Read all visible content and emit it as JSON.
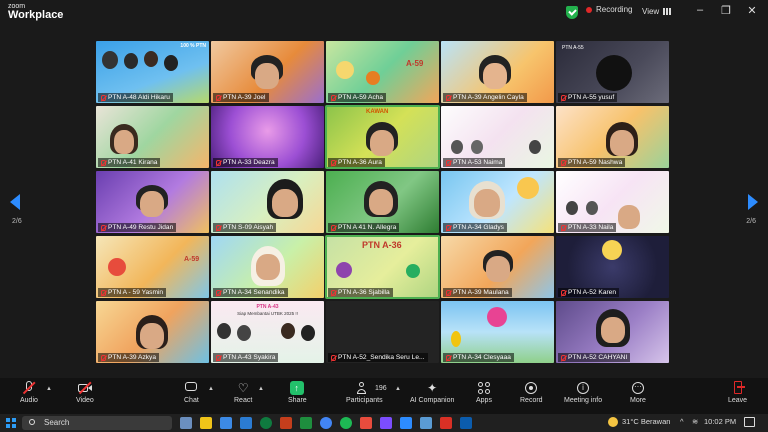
{
  "app": {
    "logo_top": "zoom",
    "logo_bottom": "Workplace"
  },
  "header": {
    "recording_label": "Recording",
    "view_label": "View"
  },
  "pagination": {
    "left": "2/6",
    "right": "2/6"
  },
  "participants": [
    {
      "name": "PTN A-48 Aldi Hikaru"
    },
    {
      "name": "PTN A-39 Joel"
    },
    {
      "name": "PTN A-59 Acha"
    },
    {
      "name": "PTN A-39 Angelin Cayla"
    },
    {
      "name": "PTN A-55 yusuf"
    },
    {
      "name": "PTN A-41 Kirana"
    },
    {
      "name": "PTN A-33 Deazra"
    },
    {
      "name": "PTN A-36 Aura"
    },
    {
      "name": "PTN A-53 Naima"
    },
    {
      "name": "PTN A-59 Nashwa"
    },
    {
      "name": "PTN A-49 Restu Jidan"
    },
    {
      "name": "PTN S-09 Aisyah"
    },
    {
      "name": "PTN A 41 N. Allegra"
    },
    {
      "name": "PTN A-34 Gladys"
    },
    {
      "name": "PTN A-33 Naila"
    },
    {
      "name": "PTN A - 59 Yasmin"
    },
    {
      "name": "PTN A-34 Senandika"
    },
    {
      "name": "PTN A-36 Sjabilla"
    },
    {
      "name": "PTN A-39 Maulana"
    },
    {
      "name": "PTN A-52 Karen"
    },
    {
      "name": "PTN A-39 Azkya"
    },
    {
      "name": "PTN A-43 Syakira"
    },
    {
      "name": "PTN A-52_Sendika Seru Le..."
    },
    {
      "name": "PTN A-34 Clesyaaa"
    },
    {
      "name": "PTN A-52 CAHYANI"
    }
  ],
  "tile_text": {
    "t0_banner": "100 % PTN",
    "t21_banner1": "PTN A-43",
    "t21_banner2": "Siap Membantai UTBK 2025 !!",
    "t17_banner": "PTN A-36",
    "t2_banner": "A-59",
    "t7_banner": "KAWAN",
    "t4_banner": "PTN A-55",
    "t15_banner": "A-59"
  },
  "toolbar": {
    "audio": "Audio",
    "video": "Video",
    "chat": "Chat",
    "react": "React",
    "share": "Share",
    "participants": "Participants",
    "participants_count": "196",
    "ai_companion": "AI Companion",
    "apps": "Apps",
    "record": "Record",
    "meeting_info": "Meeting info",
    "more": "More",
    "leave": "Leave"
  },
  "taskbar": {
    "search_label": "Search",
    "weather": "31°C Berawan",
    "time": "10:02 PM"
  },
  "colors": {
    "accent": "#2d8cff",
    "record": "#e02828",
    "share": "#23c16b",
    "leave": "#e02828"
  }
}
